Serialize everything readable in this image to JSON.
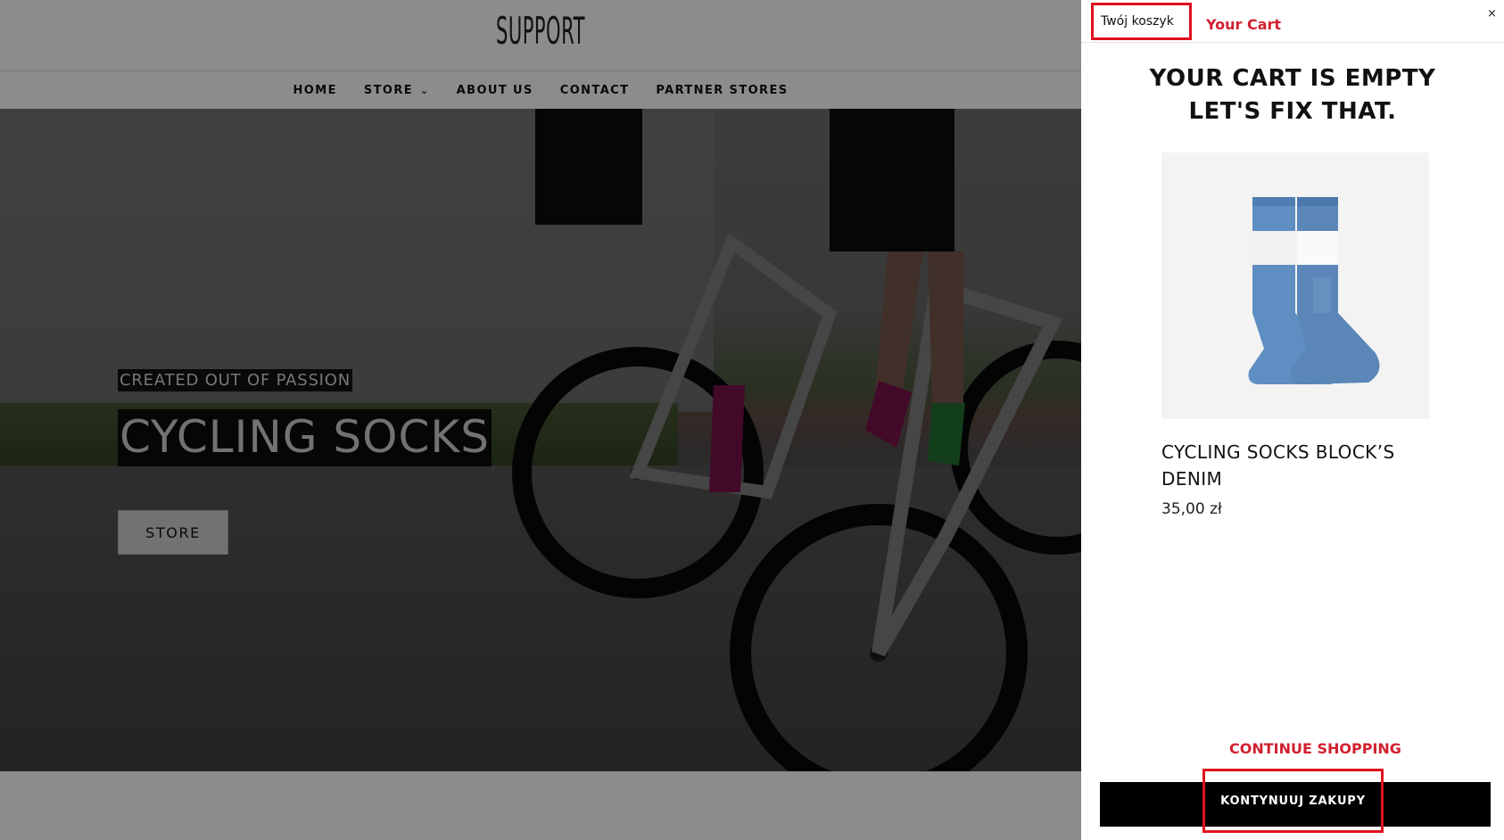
{
  "header": {
    "logo": "SUPPORT"
  },
  "nav": {
    "items": [
      {
        "label": "HOME"
      },
      {
        "label": "STORE",
        "icon": "chevron-down-icon"
      },
      {
        "label": "ABOUT US"
      },
      {
        "label": "CONTACT"
      },
      {
        "label": "PARTNER STORES"
      }
    ]
  },
  "hero": {
    "eyebrow": "CREATED OUT OF PASSION",
    "title": "CYCLING SOCKS",
    "button_label": "STORE"
  },
  "cart": {
    "tab_label": "Twój koszyk",
    "tab_translation": "Your Cart",
    "close_icon": "×",
    "empty_line1": "YOUR CART IS EMPTY",
    "empty_line2": "LET'S FIX THAT.",
    "product": {
      "name": "CYCLING SOCKS BLOCK’S DENIM",
      "price": "35,00 zł",
      "image_icon": "sock-product-icon"
    },
    "continue_translation": "CONTINUE SHOPPING",
    "continue_label": "KONTYNUUJ ZAKUPY"
  },
  "colors": {
    "accent_red": "#e0101f",
    "annotation_red": "#d22030",
    "sock_blue": "#5a86b8",
    "button_black": "#000000"
  }
}
